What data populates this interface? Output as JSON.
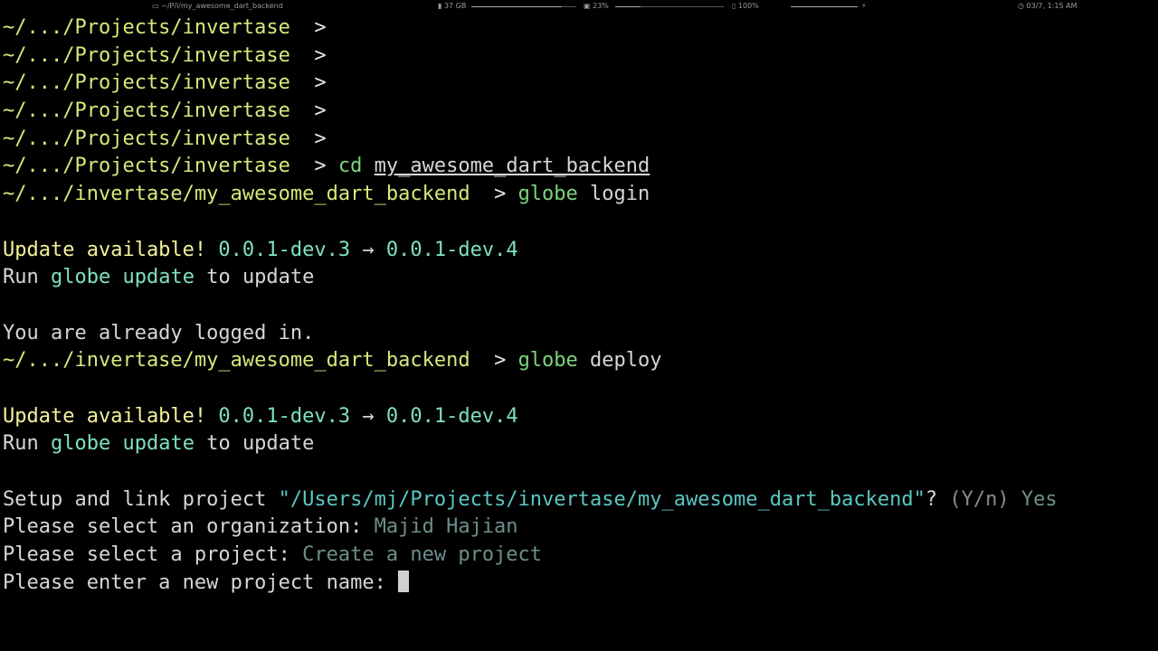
{
  "statusbar": {
    "apple_glyph": "",
    "window_title": "~/P/i/my_awesome_dart_backend",
    "memory": "37 GB",
    "memory_fraction": 0.86,
    "cpu": "23%",
    "cpu_fraction": 0.23,
    "battery": "100%",
    "battery_fraction": 1.0,
    "charge_glyph": "⚡",
    "datetime": "03/7, 1:15 AM"
  },
  "terminal": {
    "prompt_char": ">",
    "lines": [
      {
        "kind": "prompt",
        "path": "~/.../Projects/invertase",
        "gap": "  ",
        "cmd": "",
        "args": ""
      },
      {
        "kind": "prompt",
        "path": "~/.../Projects/invertase",
        "gap": "  ",
        "cmd": "",
        "args": ""
      },
      {
        "kind": "prompt",
        "path": "~/.../Projects/invertase",
        "gap": "  ",
        "cmd": "",
        "args": ""
      },
      {
        "kind": "prompt",
        "path": "~/.../Projects/invertase",
        "gap": "  ",
        "cmd": "",
        "args": ""
      },
      {
        "kind": "prompt",
        "path": "~/.../Projects/invertase",
        "gap": "  ",
        "cmd": "",
        "args": ""
      },
      {
        "kind": "prompt",
        "path": "~/.../Projects/invertase",
        "gap": "  ",
        "cmd": "cd",
        "args": "my_awesome_dart_backend",
        "underline": true
      },
      {
        "kind": "prompt",
        "path": "~/.../invertase/my_awesome_dart_backend",
        "gap": "  ",
        "cmd": "globe",
        "args": "login"
      },
      {
        "kind": "blank"
      },
      {
        "kind": "update",
        "label": "Update available!",
        "from": "0.0.1-dev.3",
        "arrow": "→",
        "to": "0.0.1-dev.4"
      },
      {
        "kind": "run",
        "pre": "Run",
        "command": "globe update",
        "post": "to update"
      },
      {
        "kind": "blank"
      },
      {
        "kind": "text",
        "text": "You are already logged in."
      },
      {
        "kind": "prompt",
        "path": "~/.../invertase/my_awesome_dart_backend",
        "gap": "  ",
        "cmd": "globe",
        "args": "deploy"
      },
      {
        "kind": "blank"
      },
      {
        "kind": "update",
        "label": "Update available!",
        "from": "0.0.1-dev.3",
        "arrow": "→",
        "to": "0.0.1-dev.4"
      },
      {
        "kind": "run",
        "pre": "Run",
        "command": "globe update",
        "post": "to update"
      },
      {
        "kind": "blank"
      },
      {
        "kind": "question",
        "q": "Setup and link project",
        "quoted": "\"/Users/mj/Projects/invertase/my_awesome_dart_backend\"",
        "suffix": "?",
        "hint": "(Y/n)",
        "answer": "Yes"
      },
      {
        "kind": "question",
        "q": "Please select an organization:",
        "quoted": "",
        "suffix": "",
        "hint": "",
        "answer": "Majid Hajian"
      },
      {
        "kind": "question",
        "q": "Please select a project:",
        "quoted": "",
        "suffix": "",
        "hint": "",
        "answer": "Create a new project"
      },
      {
        "kind": "input",
        "q": "Please enter a new project name:",
        "value": ""
      }
    ]
  }
}
